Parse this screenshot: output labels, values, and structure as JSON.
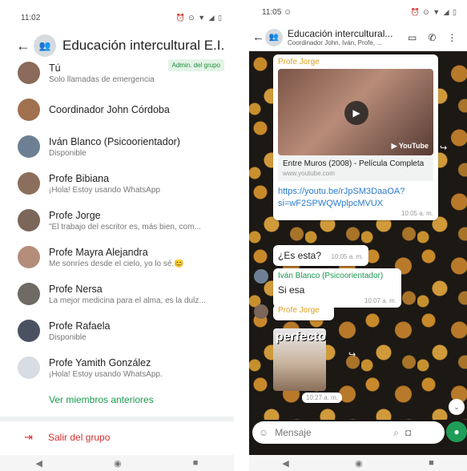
{
  "left": {
    "status_time": "11:02",
    "status_icons": "⏰ ⊙ ▼ ◢ ▯",
    "title": "Educación intercultural E.I.",
    "members": [
      {
        "name": "Tú",
        "status": "Solo llamadas de emergencia",
        "badge": "Admin. del grupo",
        "color": "#8a6a5a"
      },
      {
        "name": "Coordinador John Córdoba",
        "status": "",
        "badge": "",
        "color": "#a0704f"
      },
      {
        "name": "Iván Blanco (Psicoorientador)",
        "status": "Disponible",
        "badge": "",
        "color": "#6d7f93"
      },
      {
        "name": "Profe Bibiana",
        "status": "¡Hola! Estoy usando WhatsApp",
        "badge": "",
        "color": "#8c6e5d"
      },
      {
        "name": "Profe Jorge",
        "status": "\"El trabajo del escritor es, más bien, com...",
        "badge": "",
        "color": "#7b6659"
      },
      {
        "name": "Profe Mayra Alejandra",
        "status": "Me sonríes desde el cielo, yo lo sé.😊",
        "badge": "",
        "color": "#b48d7a"
      },
      {
        "name": "Profe Nersa",
        "status": "La mejor medicina para el alma, es la dulz...",
        "badge": "",
        "color": "#6f6a63"
      },
      {
        "name": "Profe Rafaela",
        "status": "Disponible",
        "badge": "",
        "color": "#4a5261"
      },
      {
        "name": "Profe Yamith González",
        "status": "¡Hola! Estoy usando WhatsApp.",
        "badge": "",
        "color": "#d7dde3"
      }
    ],
    "ver_anteriores": "Ver miembros anteriores",
    "salir": "Salir del grupo"
  },
  "right": {
    "status_time": "11:05 ☺",
    "status_icons": "⏰ ⊙ ▼ ◢ ▯",
    "title": "Educación intercultural...",
    "subtitle": "Coordinador John, Iván, Profe, ...",
    "msg1": {
      "sender": "Profe Jorge",
      "video_brand": "▶ YouTube",
      "preview_title": "Entre Muros (2008) - Película Completa",
      "preview_url": "www.youtube.com",
      "link": "https://youtu.be/rJpSM3DaaOA?si=wF2SPWQWplpcMVUX",
      "time": "10:05 a. m."
    },
    "msg2": {
      "text": "¿Es esta?",
      "time": "10:05 a. m."
    },
    "msg3": {
      "sender": "Iván Blanco (Psicoorientador)",
      "text": "Si esa",
      "time": "10:07 a. m."
    },
    "msg4": {
      "sender": "Profe Jorge",
      "sticker_text": "perfecto",
      "time": "10:27 a. m."
    },
    "input_placeholder": "Mensaje"
  }
}
